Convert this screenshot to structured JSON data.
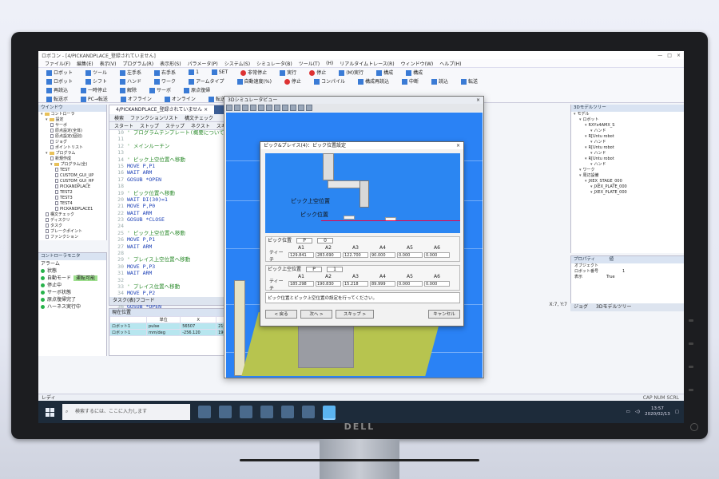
{
  "app": {
    "title": "ロボコン - [4/PICKANDPLACE_登録されていません]",
    "window_controls": [
      "—",
      "□",
      "×"
    ]
  },
  "menu": [
    "ファイル(F)",
    "編集(E)",
    "表示(V)",
    "プログラム(R)",
    "表示形(S)",
    "パラメータ(P)",
    "システム(S)",
    "シミュレータ(B)",
    "ツール(T)",
    "(H)",
    "リアルタイムトレース(R)",
    "ウィンドウ(W)",
    "ヘルプ(H)"
  ],
  "ribbon": {
    "row1": [
      "ロボット",
      "ツール",
      "左手系",
      "右手系",
      "1",
      "SET",
      "非常停止",
      "実行",
      "停止",
      "(M)実行",
      "構成",
      "構成"
    ],
    "row2": [
      "ロボット",
      "シフト",
      "ハンド",
      "ワーク",
      "アームタイプ",
      "自動速度(%)",
      "停止",
      "コンパイル",
      "構成再読込",
      "中断",
      "読込",
      "転送"
    ],
    "row3": [
      "再読込",
      "一時停止",
      "解除",
      "サーボ",
      "原点復帰"
    ],
    "row4": [
      "転送ボ",
      "PC→転送",
      "オフライン",
      "オンライン",
      "転送済オンライン"
    ]
  },
  "left_panel": {
    "title": "ウインドウ",
    "items": [
      {
        "level": 0,
        "type": "folder",
        "label": "コントローラ"
      },
      {
        "level": 1,
        "type": "folder",
        "label": "設定"
      },
      {
        "level": 2,
        "type": "file",
        "label": "サーボ"
      },
      {
        "level": 2,
        "type": "file",
        "label": "原点設定(全体)"
      },
      {
        "level": 2,
        "type": "file",
        "label": "原点設定(個別)"
      },
      {
        "level": 2,
        "type": "file",
        "label": "ジョグ"
      },
      {
        "level": 2,
        "type": "file",
        "label": "ポイントリスト"
      },
      {
        "level": 1,
        "type": "folder",
        "label": "プログラム"
      },
      {
        "level": 2,
        "type": "file",
        "label": "新規作成"
      },
      {
        "level": 2,
        "type": "folder",
        "label": "プログラム(全)"
      },
      {
        "level": 3,
        "type": "file",
        "label": "TEST"
      },
      {
        "level": 3,
        "type": "file",
        "label": "CUSTOM_GUI_UP"
      },
      {
        "level": 3,
        "type": "file",
        "label": "CUSTOM_GUI_HP"
      },
      {
        "level": 3,
        "type": "file",
        "label": "PICKANDPLACE"
      },
      {
        "level": 3,
        "type": "file",
        "label": "TEST2"
      },
      {
        "level": 3,
        "type": "file",
        "label": "TEST3"
      },
      {
        "level": 3,
        "type": "file",
        "label": "TEST4"
      },
      {
        "level": 3,
        "type": "file",
        "label": "PICKANDPLACE1"
      },
      {
        "level": 1,
        "type": "file",
        "label": "構文チェック"
      },
      {
        "level": 1,
        "type": "file",
        "label": "ディスクリ"
      },
      {
        "level": 1,
        "type": "file",
        "label": "タスク"
      },
      {
        "level": 1,
        "type": "file",
        "label": "ブレークポイント"
      },
      {
        "level": 1,
        "type": "file",
        "label": "ファンクション"
      }
    ]
  },
  "control_panel": {
    "title": "コントローラモニタ",
    "sub": "アラーム",
    "rows": [
      {
        "label": "状態",
        "badge": ""
      },
      {
        "label": "自動モード",
        "badge": "運転可能"
      },
      {
        "label": "停止中",
        "badge": ""
      },
      {
        "label": "サーボ状態",
        "badge": ""
      },
      {
        "label": "原点復帰完了",
        "badge": ""
      },
      {
        "label": "ハーネス実行中",
        "badge": ""
      }
    ]
  },
  "editor": {
    "tab": "4/PICKANDPLACE_登録されていません",
    "tab_close": "×",
    "toolbar_top": [
      "検索",
      "ファンクションリスト",
      "構文チェック"
    ],
    "toolbar": [
      "スタート",
      "ストップ",
      "ステップ",
      "ネクスト",
      "スキップ",
      "ラントウ"
    ],
    "first_line": 10,
    "lines": [
      {
        "t": "' プログラムテンプレート(概要について)",
        "c": "cm"
      },
      {
        "t": "",
        "c": ""
      },
      {
        "t": "' メインルーチン",
        "c": "cm"
      },
      {
        "t": "",
        "c": ""
      },
      {
        "t": "' ピック上空位置へ移動",
        "c": "cm"
      },
      {
        "t": "MOVE P,P1",
        "c": "kw"
      },
      {
        "t": "WAIT ARM",
        "c": "kw"
      },
      {
        "t": "GOSUB *OPEN",
        "c": "kw"
      },
      {
        "t": "",
        "c": ""
      },
      {
        "t": "' ピック位置へ移動",
        "c": "cm"
      },
      {
        "t": "WAIT DI(30)=1",
        "c": "kw"
      },
      {
        "t": "MOVE P,P0",
        "c": "kw"
      },
      {
        "t": "WAIT ARM",
        "c": "kw"
      },
      {
        "t": "GOSUB *CLOSE",
        "c": "kw"
      },
      {
        "t": "",
        "c": ""
      },
      {
        "t": "' ピック上空位置へ移動",
        "c": "cm"
      },
      {
        "t": "MOVE P,P1",
        "c": "kw"
      },
      {
        "t": "WAIT ARM",
        "c": "kw"
      },
      {
        "t": "",
        "c": ""
      },
      {
        "t": "' プレイス上空位置へ移動",
        "c": "cm"
      },
      {
        "t": "MOVE P,P3",
        "c": "kw"
      },
      {
        "t": "WAIT ARM",
        "c": "kw"
      },
      {
        "t": "",
        "c": ""
      },
      {
        "t": "' プレイス位置へ移動",
        "c": "cm"
      },
      {
        "t": "MOVE P,P2",
        "c": "kw"
      },
      {
        "t": "WAIT ARM",
        "c": "kw"
      },
      {
        "t": "GOSUB *OPEN",
        "c": "kw"
      }
    ],
    "footer": "タスク(表)フコード"
  },
  "position_panel": {
    "title": "現在位置",
    "headers": [
      "",
      "単位",
      "X",
      "Y",
      "Z"
    ],
    "rows": [
      [
        "ロボット1",
        "pulse",
        "56507",
        "219669",
        "209466"
      ],
      [
        "ロボット1",
        "mm/deg",
        "-256.120",
        "190.001",
        "122.700"
      ]
    ]
  },
  "right_panel": {
    "title": "3Dモデルツリー",
    "items": [
      {
        "level": 0,
        "label": "モデル"
      },
      {
        "level": 1,
        "label": "ロボット"
      },
      {
        "level": 2,
        "label": "RXYx4AMX_S"
      },
      {
        "level": 3,
        "label": "ハンド"
      },
      {
        "level": 2,
        "label": "R[Untu robot"
      },
      {
        "level": 3,
        "label": "ハンド"
      },
      {
        "level": 2,
        "label": "R[Untu robot"
      },
      {
        "level": 3,
        "label": "ハンド"
      },
      {
        "level": 2,
        "label": "R[Untu robot"
      },
      {
        "level": 3,
        "label": "ハンド"
      },
      {
        "level": 1,
        "label": "ワーク"
      },
      {
        "level": 1,
        "label": "周辺設備"
      },
      {
        "level": 2,
        "label": "JXEX_STAGE_000"
      },
      {
        "level": 3,
        "label": "JXEX_PLATE_000"
      },
      {
        "level": 3,
        "label": "JXEX_PLATE_000"
      }
    ]
  },
  "prop_panel": {
    "title": "プロパティ",
    "col2": "値",
    "rows": [
      [
        "オブジェクト",
        ""
      ],
      [
        "ロボット番号",
        "1"
      ],
      [
        "表示",
        "True"
      ]
    ]
  },
  "right_tabs": [
    "ジョグ",
    "3Dモデルツリー"
  ],
  "status_coords": "X:7, Y:7",
  "statusbar": {
    "left": "レディ",
    "right": "CAP  NUM  SCRL"
  },
  "sim": {
    "title": "3Dシミュレータビュー",
    "close": "×"
  },
  "dialog": {
    "title": "ピック&プレイス(4)：ピック位置設定",
    "close": "×",
    "preview_labels": [
      "ピック上空位置",
      "ピック位置"
    ],
    "group1": {
      "title": "ピック位置",
      "point": "P",
      "point_no": "0",
      "axes": [
        "A1",
        "A2",
        "A3",
        "A4",
        "A5",
        "A6"
      ],
      "row_label": "ティーチ",
      "values": [
        "129.841",
        "283.690",
        "122.700",
        "90.000",
        "0.000",
        "0.000"
      ]
    },
    "group2": {
      "title": "ピック上空位置",
      "point": "P",
      "point_no": "1",
      "axes": [
        "A1",
        "A2",
        "A3",
        "A4",
        "A5",
        "A6"
      ],
      "row_label": "ティーチ",
      "values": [
        "185.298",
        "190.830",
        "15.218",
        "89.999",
        "0.000",
        "0.000"
      ]
    },
    "info": "ピック位置とピック上空位置の設定を行ってください。",
    "buttons": {
      "back": "< 戻る",
      "next": "次へ >",
      "skip": "スキップ >",
      "cancel": "キャンセル"
    }
  },
  "taskbar": {
    "search_placeholder": "検索するには、ここに入力します",
    "time": "13:57",
    "date": "2020/02/13"
  },
  "monitor": {
    "brand": "DELL"
  }
}
